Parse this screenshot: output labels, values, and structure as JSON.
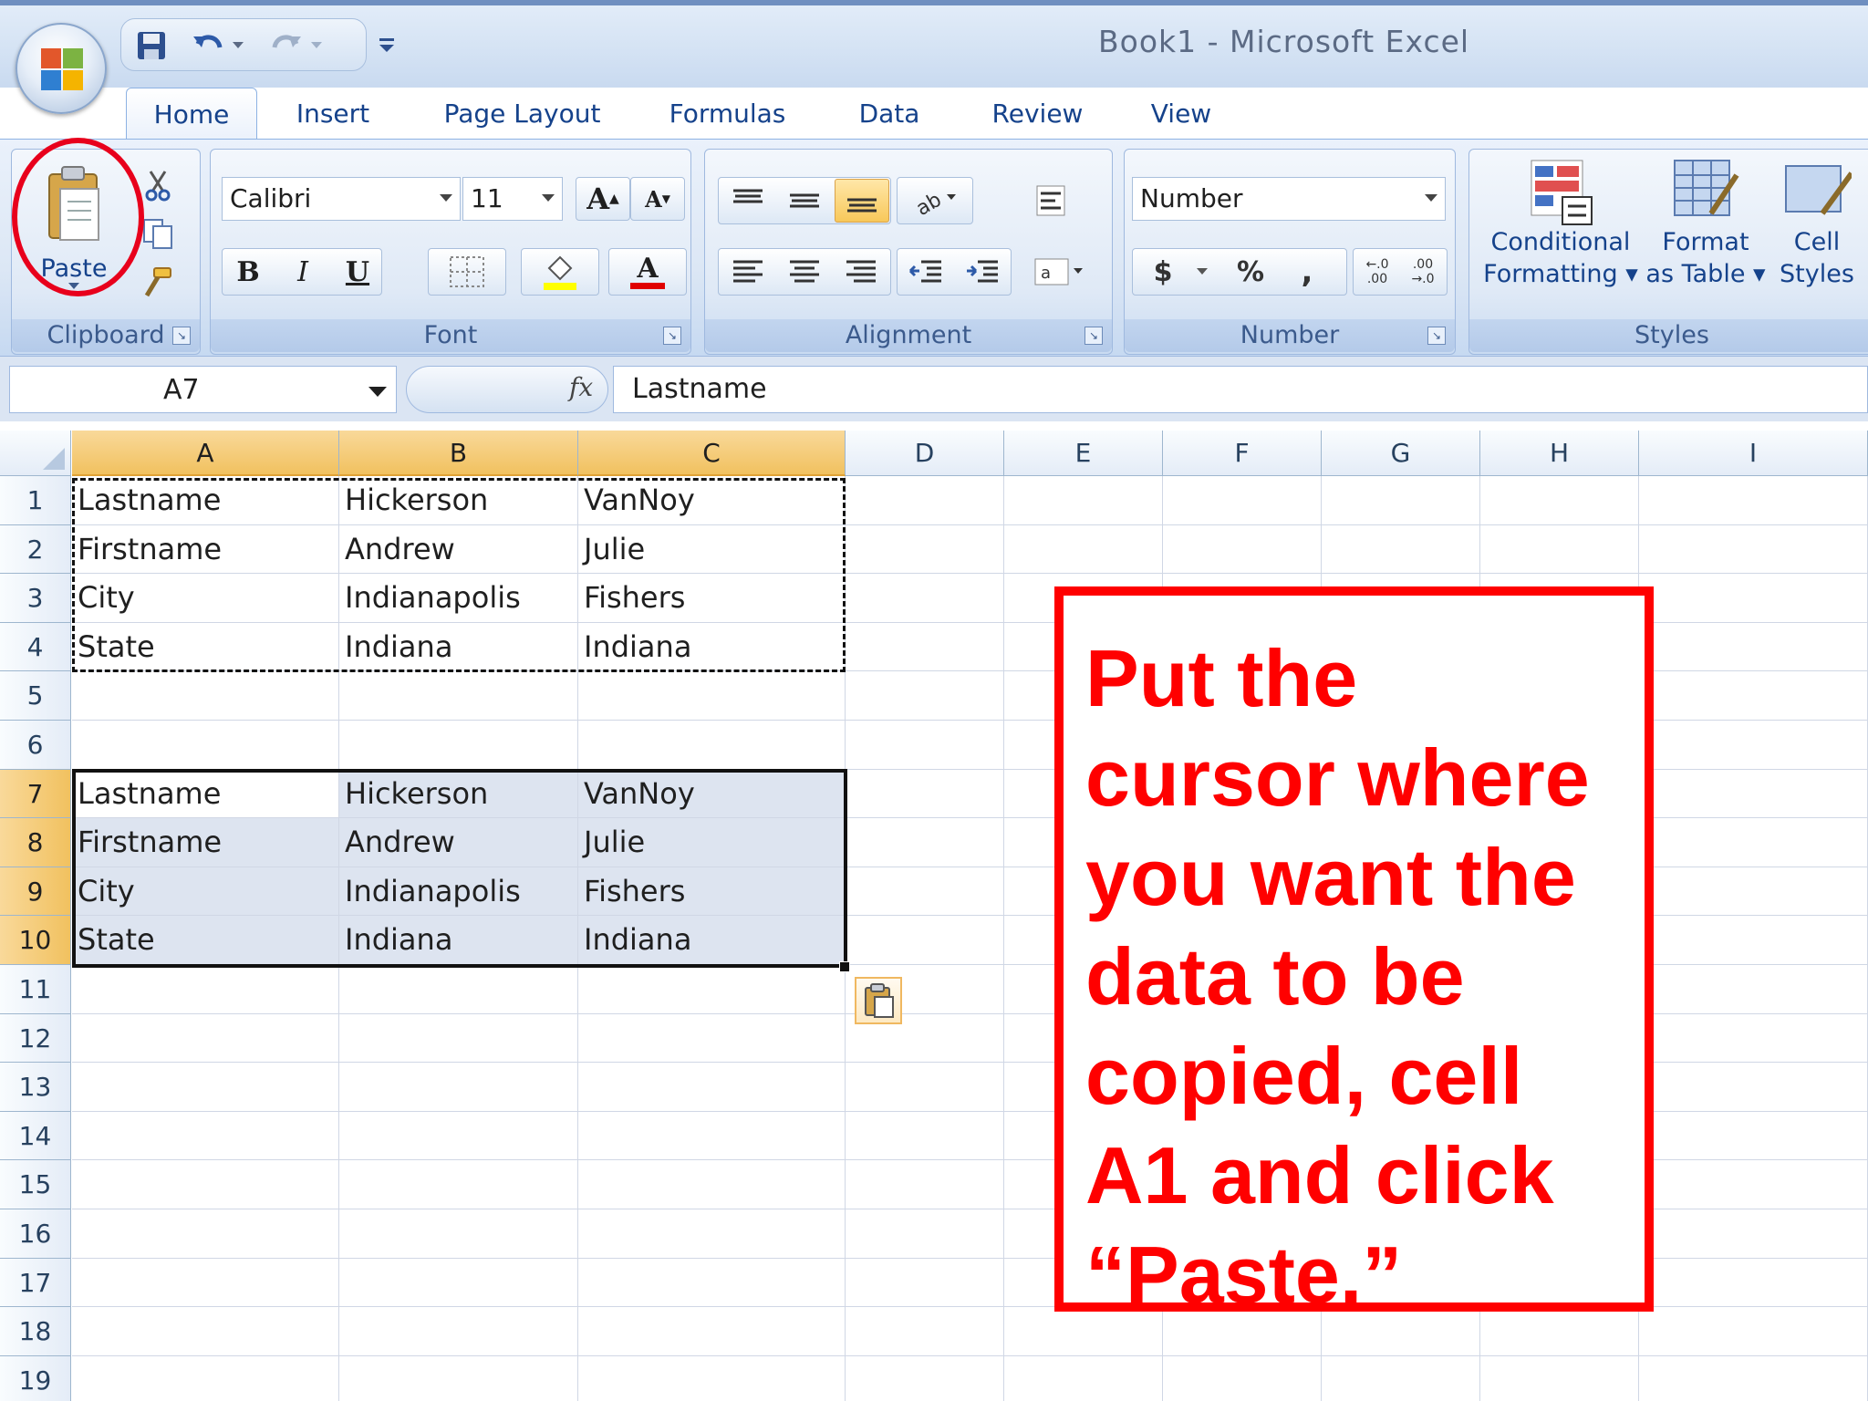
{
  "window": {
    "title": "Book1  -  Microsoft Excel"
  },
  "tabs": [
    "Home",
    "Insert",
    "Page Layout",
    "Formulas",
    "Data",
    "Review",
    "View"
  ],
  "ribbon": {
    "clipboard": {
      "label": "Clipboard",
      "paste": "Paste"
    },
    "font": {
      "label": "Font",
      "name": "Calibri",
      "size": "11",
      "bold": "B",
      "italic": "I",
      "underline": "U",
      "grow": "A",
      "shrink": "A",
      "color_a": "A"
    },
    "alignment": {
      "label": "Alignment"
    },
    "number": {
      "label": "Number",
      "format": "Number",
      "currency": "$",
      "percent": "%",
      "comma": ",",
      "inc_decimal": "←.0 .00",
      "dec_decimal": ".00 →.0"
    },
    "styles": {
      "label": "Styles",
      "conditional": "Conditional",
      "conditional2": "Formatting",
      "format_table": "Format",
      "format_table2": "as Table",
      "cell_styles": "Cell",
      "cell_styles2": "Styles"
    }
  },
  "formula_bar": {
    "name_box": "A7",
    "fx": "fx",
    "value": "Lastname"
  },
  "columns": [
    "A",
    "B",
    "C",
    "D",
    "E",
    "F",
    "G",
    "H",
    "I"
  ],
  "rows": [
    "1",
    "2",
    "3",
    "4",
    "5",
    "6",
    "7",
    "8",
    "9",
    "10",
    "11",
    "12",
    "13",
    "14",
    "15",
    "16",
    "17",
    "18",
    "19"
  ],
  "cells": {
    "r1": [
      "Lastname",
      "Hickerson",
      "VanNoy"
    ],
    "r2": [
      "Firstname",
      "Andrew",
      "Julie"
    ],
    "r3": [
      "City",
      "Indianapolis",
      "Fishers"
    ],
    "r4": [
      "State",
      "Indiana",
      "Indiana"
    ],
    "r7": [
      "Lastname",
      "Hickerson",
      "VanNoy"
    ],
    "r8": [
      "Firstname",
      "Andrew",
      "Julie"
    ],
    "r9": [
      "City",
      "Indianapolis",
      "Fishers"
    ],
    "r10": [
      "State",
      "Indiana",
      "Indiana"
    ]
  },
  "callout": {
    "lines": [
      "Put the",
      "cursor where",
      "you want the",
      "data to be",
      "copied, cell",
      "A1 and click",
      "“Paste.”"
    ]
  },
  "colors": {
    "annotation_red": "#ff0000",
    "selection_header": "#f1c15f",
    "ribbon_blue": "#dce7f5"
  }
}
